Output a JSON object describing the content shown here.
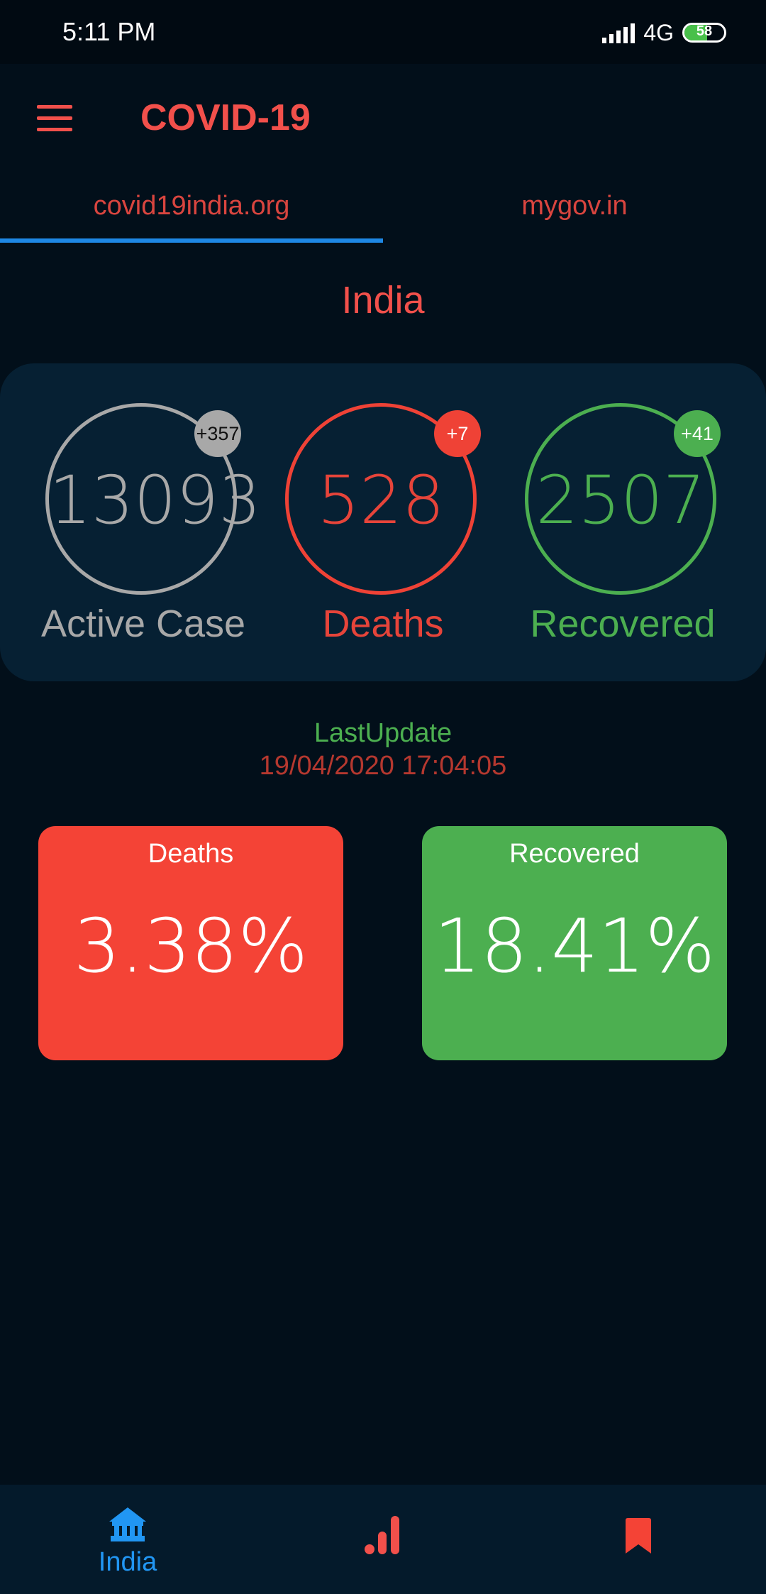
{
  "status_bar": {
    "time": "5:11 PM",
    "network": "4G",
    "battery_level": 58,
    "battery_text": "58"
  },
  "app_bar": {
    "menu_icon": "menu-icon",
    "title": "COVID-19"
  },
  "tabs": [
    {
      "label": "covid19india.org",
      "selected": true
    },
    {
      "label": "mygov.in",
      "selected": false
    }
  ],
  "region": "India",
  "stats": {
    "active": {
      "value": "13093",
      "change": "+357",
      "label": "Active Case"
    },
    "deaths": {
      "value": "528",
      "change": "+7",
      "label": "Deaths"
    },
    "recovered": {
      "value": "2507",
      "change": "+41",
      "label": "Recovered"
    }
  },
  "last_update": {
    "label": "LastUpdate",
    "time": "19/04/2020 17:04:05"
  },
  "rates": {
    "deaths": {
      "title": "Deaths",
      "value": "3.38%"
    },
    "recovered": {
      "title": "Recovered",
      "value": "18.41%"
    }
  },
  "bottom_nav": [
    {
      "icon": "home-icon",
      "label": "India",
      "active": true
    },
    {
      "icon": "bar-chart-icon",
      "label": "",
      "active": false
    },
    {
      "icon": "bookmark-icon",
      "label": "",
      "active": false
    }
  ],
  "colors": {
    "background": "#020f1a",
    "accent_red": "#f2504b",
    "deaths_red": "#f44336",
    "recovered_green": "#4caf50",
    "active_grey": "#a8a8a8",
    "tab_indicator_blue": "#1e88e5",
    "nav_active_blue": "#2196f3"
  }
}
